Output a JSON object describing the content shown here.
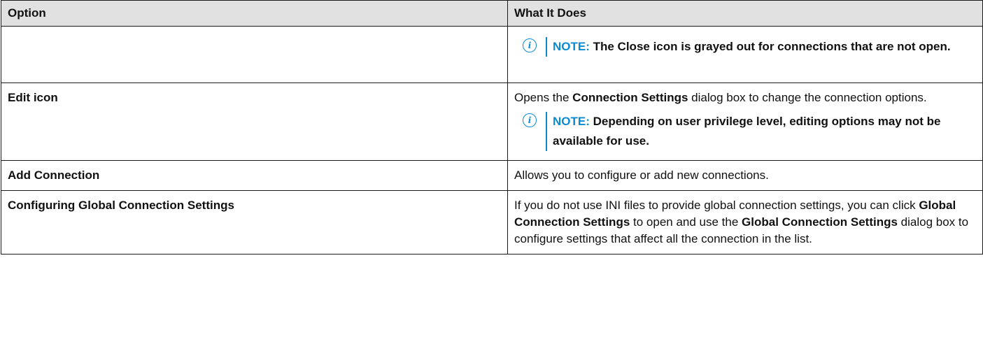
{
  "table": {
    "headers": {
      "option": "Option",
      "what": "What It Does"
    },
    "row1": {
      "note_label": "NOTE:",
      "note_text": " The Close icon is grayed out for connections that are not open."
    },
    "row2": {
      "option": "Edit icon",
      "desc_pre": "Opens the ",
      "desc_bold": "Connection Settings",
      "desc_post": " dialog box to change the connection options.",
      "note_label": "NOTE:",
      "note_text": " Depending on user privilege level, editing options may not be available for use."
    },
    "row3": {
      "option": "Add Connection",
      "desc": "Allows you to configure or add new connections."
    },
    "row4": {
      "option": "Configuring Global Connection Settings",
      "desc_1": "If you do not use INI files to provide global connection settings, you can click ",
      "desc_bold_1": "Global Connection Settings",
      "desc_2": " to open and use the ",
      "desc_bold_2": "Global Connection Settings",
      "desc_3": " dialog box to configure settings that affect all the connection in the list."
    }
  },
  "icons": {
    "note": "info-circle-icon",
    "note_glyph": "i"
  },
  "colors": {
    "accent": "#0a8bd1",
    "header_bg": "#e1e1e1"
  }
}
